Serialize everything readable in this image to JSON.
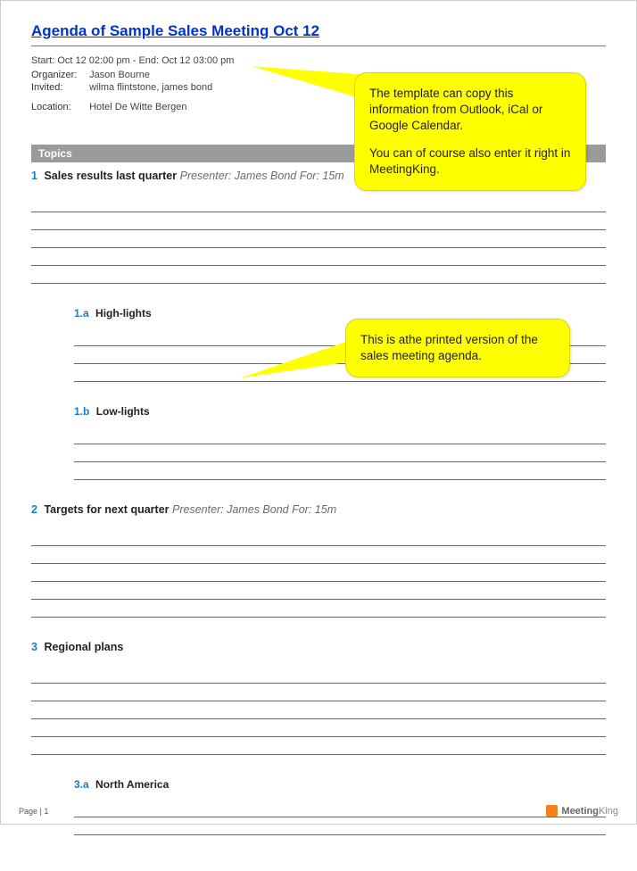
{
  "title": "Agenda of Sample Sales Meeting Oct 12",
  "datetime": "Start: Oct 12 02:00 pm - End: Oct 12 03:00 pm",
  "organizer_label": "Organizer:",
  "organizer": "Jason Bourne",
  "invited_label": "Invited:",
  "invited": "wilma flintstone, james bond",
  "location_label": "Location:",
  "location": "Hotel De Witte Bergen",
  "section_topics": "Topics",
  "topics": [
    {
      "num": "1",
      "title": "Sales results last quarter",
      "meta": "Presenter: James Bond For: 15m",
      "subs": [
        {
          "num": "1.a",
          "title": "High-lights"
        },
        {
          "num": "1.b",
          "title": "Low-lights"
        }
      ]
    },
    {
      "num": "2",
      "title": "Targets for next quarter",
      "meta": "Presenter: James Bond For: 15m",
      "subs": []
    },
    {
      "num": "3",
      "title": "Regional plans",
      "meta": "",
      "subs": [
        {
          "num": "3.a",
          "title": "North America"
        }
      ]
    }
  ],
  "callout1_p1": "The template can copy this information from Outlook, iCal or Google Calendar.",
  "callout1_p2": "You can of course also enter it right in MeetingKing.",
  "callout2": "This is athe printed version of the sales meeting agenda.",
  "footer_page": "Page | 1",
  "brand_meeting": "Meeting",
  "brand_king": "King"
}
